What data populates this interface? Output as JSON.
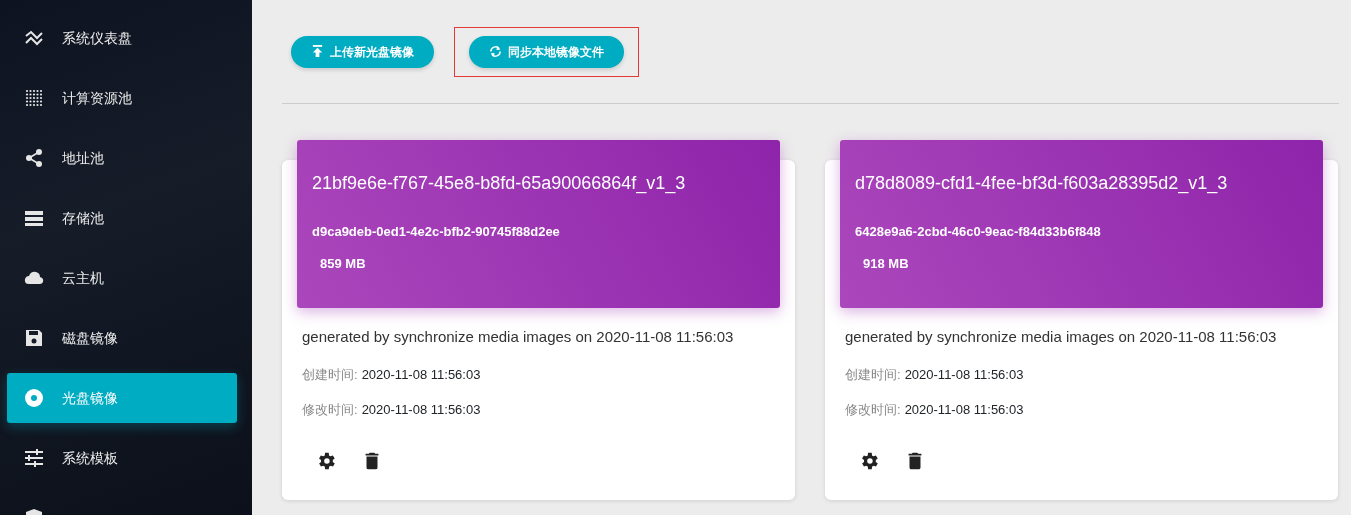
{
  "sidebar": {
    "items": [
      {
        "kind": "chart",
        "label": "系统仪表盘",
        "selected": false
      },
      {
        "kind": "grid",
        "label": "计算资源池",
        "selected": false
      },
      {
        "kind": "share",
        "label": "地址池",
        "selected": false
      },
      {
        "kind": "list",
        "label": "存储池",
        "selected": false
      },
      {
        "kind": "cloud",
        "label": "云主机",
        "selected": false
      },
      {
        "kind": "floppy",
        "label": "磁盘镜像",
        "selected": false
      },
      {
        "kind": "disc",
        "label": "光盘镜像",
        "selected": true
      },
      {
        "kind": "sliders",
        "label": "系统模板",
        "selected": false
      },
      {
        "kind": "shield",
        "selected": false
      }
    ]
  },
  "toolbar": {
    "buttons": [
      {
        "kind": "upload",
        "label": "上传新光盘镜像",
        "highlighted": false
      },
      {
        "kind": "sync",
        "label": "同步本地镜像文件",
        "highlighted": true
      }
    ]
  },
  "images": [
    {
      "name": "21bf9e6e-f767-45e8-b8fd-65a90066864f_v1_3",
      "id": "d9ca9deb-0ed1-4e2c-bfb2-90745f88d2ee",
      "size": "859 MB",
      "description": "generated by synchronize media images on 2020-11-08 11:56:03",
      "created_label": "创建时间:",
      "created": "2020-11-08 11:56:03",
      "modified_label": "修改时间:",
      "modified": "2020-11-08 11:56:03"
    },
    {
      "name": "d78d8089-cfd1-4fee-bf3d-f603a28395d2_v1_3",
      "id": "6428e9a6-2cbd-46c0-9eac-f84d33b6f848",
      "size": "918 MB",
      "description": "generated by synchronize media images on 2020-11-08 11:56:03",
      "created_label": "创建时间:",
      "created": "2020-11-08 11:56:03",
      "modified_label": "修改时间:",
      "modified": "2020-11-08 11:56:03"
    }
  ]
}
